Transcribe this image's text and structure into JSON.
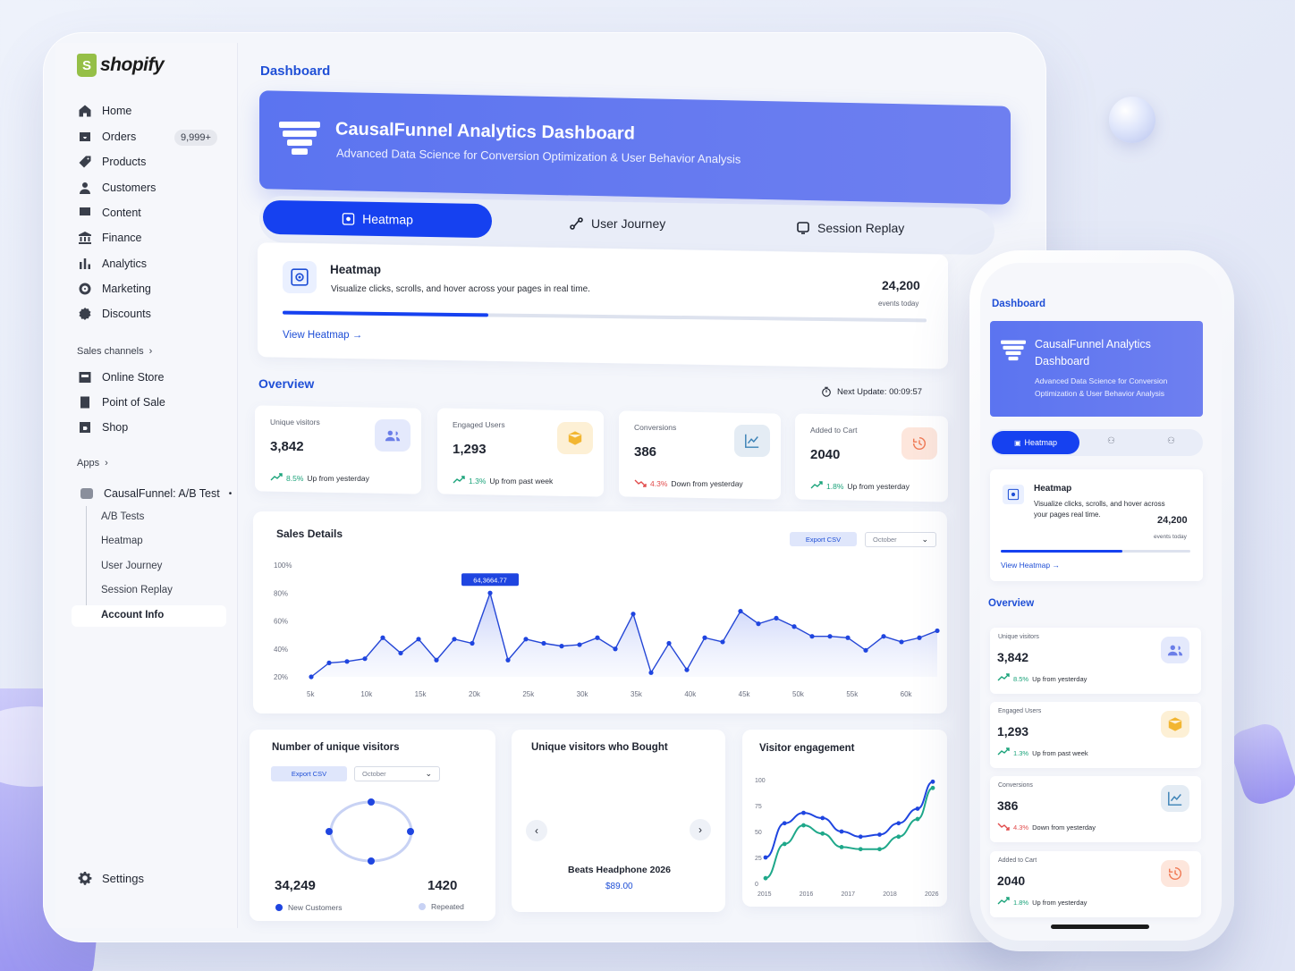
{
  "brand": {
    "name": "shopify"
  },
  "nav": [
    {
      "label": "Home",
      "icon": "home-icon"
    },
    {
      "label": "Orders",
      "icon": "orders-icon",
      "badge": "9,999+"
    },
    {
      "label": "Products",
      "icon": "tag-icon"
    },
    {
      "label": "Customers",
      "icon": "person-icon"
    },
    {
      "label": "Content",
      "icon": "content-icon"
    },
    {
      "label": "Finance",
      "icon": "bank-icon"
    },
    {
      "label": "Analytics",
      "icon": "bar-chart-icon"
    },
    {
      "label": "Marketing",
      "icon": "target-icon"
    },
    {
      "label": "Discounts",
      "icon": "discount-icon"
    }
  ],
  "sales_channels": {
    "title": "Sales channels",
    "items": [
      {
        "label": "Online Store",
        "icon": "store-icon"
      },
      {
        "label": "Point of Sale",
        "icon": "pos-icon"
      },
      {
        "label": "Shop",
        "icon": "shop-icon"
      }
    ]
  },
  "apps": {
    "title": "Apps",
    "app_name": "CausalFunnel: A/B Test",
    "sub_items": [
      "A/B Tests",
      "Heatmap",
      "User Journey",
      "Session Replay",
      "Account Info"
    ]
  },
  "settings_label": "Settings",
  "page_title": "Dashboard",
  "banner": {
    "title": "CausalFunnel Analytics Dashboard",
    "subtitle": "Advanced Data Science for Conversion Optimization & User Behavior Analysis"
  },
  "tabs": [
    "Heatmap",
    "User Journey",
    "Session Replay"
  ],
  "heatmap_card": {
    "title": "Heatmap",
    "description": "Visualize clicks, scrolls, and hover across your pages in real time.",
    "count": "24,200",
    "count_label": "events today",
    "progress": 0.32,
    "link": "View Heatmap"
  },
  "overview": {
    "title": "Overview",
    "next_update_label": "Next Update: 00:09:57",
    "stats": [
      {
        "label": "Unique visitors",
        "value": "3,842",
        "change": "8.5%",
        "change_text": "Up from yesterday",
        "direction": "up",
        "icon": "users-icon",
        "icon_bg": "#e4e9fc",
        "icon_color": "#6b7ee8"
      },
      {
        "label": "Engaged Users",
        "value": "1,293",
        "change": "1.3%",
        "change_text": "Up from past week",
        "direction": "up",
        "icon": "box-icon",
        "icon_bg": "#fdf0d5",
        "icon_color": "#f2b632"
      },
      {
        "label": "Conversions",
        "value": "386",
        "change": "4.3%",
        "change_text": "Down from yesterday",
        "direction": "down",
        "icon": "line-chart-icon",
        "icon_bg": "#e4ecf4",
        "icon_color": "#3b82b6"
      },
      {
        "label": "Added to Cart",
        "value": "2040",
        "change": "1.8%",
        "change_text": "Up from yesterday",
        "direction": "up",
        "icon": "history-icon",
        "icon_bg": "#fde6dc",
        "icon_color": "#f07a55"
      }
    ]
  },
  "sales_details": {
    "title": "Sales Details",
    "export_label": "Export CSV",
    "month": "October",
    "tooltip": "64,3664.77"
  },
  "unique_visitors_card": {
    "title": "Number of unique visitors",
    "export_label": "Export CSV",
    "month": "October",
    "new_value": "34,249",
    "new_label": "New Customers",
    "repeat_value": "1420",
    "repeat_label": "Repeated"
  },
  "bought_card": {
    "title": "Unique visitors who Bought",
    "product_name": "Beats Headphone 2026",
    "product_price": "$89.00"
  },
  "engagement_card": {
    "title": "Visitor engagement"
  },
  "chart_data": [
    {
      "type": "area",
      "title": "Sales Details",
      "x_ticks": [
        "5k",
        "10k",
        "15k",
        "20k",
        "25k",
        "30k",
        "35k",
        "40k",
        "45k",
        "50k",
        "55k",
        "60k"
      ],
      "y_ticks": [
        "20%",
        "40%",
        "60%",
        "80%",
        "100%"
      ],
      "ylim": [
        20,
        100
      ],
      "x": [
        5000,
        6500,
        8500,
        10000,
        11300,
        13300,
        15500,
        17500,
        20000,
        20500,
        22200,
        23200,
        24700,
        27000,
        29700,
        31300,
        33000,
        35000,
        36300,
        37800,
        40000,
        41500,
        43300,
        45000,
        46700,
        48300,
        50000,
        51700,
        53300,
        55000,
        57000,
        58700,
        60000,
        61200
      ],
      "values": [
        20,
        30,
        31,
        33,
        48,
        37,
        47,
        32,
        47,
        44,
        80,
        32,
        47,
        44,
        42,
        43,
        48,
        40,
        65,
        23,
        44,
        25,
        48,
        45,
        67,
        58,
        62,
        56,
        49,
        49,
        48,
        39,
        49,
        45,
        48,
        53
      ],
      "series": [
        {
          "name": "Sales",
          "values": [
            20,
            30,
            31,
            33,
            48,
            37,
            47,
            32,
            47,
            44,
            80,
            32,
            47,
            44,
            42,
            43,
            48,
            40,
            65,
            23,
            44,
            25,
            48,
            45,
            67,
            58,
            62,
            56,
            49,
            49,
            48,
            39,
            49,
            45,
            48,
            53
          ]
        }
      ],
      "annotation": "64,3664.77"
    },
    {
      "type": "line",
      "title": "Visitor engagement",
      "x_ticks": [
        "2015",
        "2016",
        "2017",
        "2018",
        "2026"
      ],
      "y_ticks": [
        "0",
        "25",
        "50",
        "75",
        "100"
      ],
      "ylim": [
        0,
        100
      ],
      "series": [
        {
          "color": "#1f45e0",
          "x": [
            2015,
            2015.5,
            2016,
            2016.5,
            2017,
            2017.5,
            2018,
            2018.5,
            2019,
            2019.4
          ],
          "values": [
            25,
            58,
            68,
            63,
            50,
            45,
            47,
            58,
            72,
            98
          ]
        },
        {
          "color": "#1fa88a",
          "x": [
            2015,
            2015.5,
            2016,
            2016.5,
            2017,
            2017.5,
            2018,
            2018.5,
            2019,
            2019.4
          ],
          "values": [
            5,
            38,
            56,
            48,
            35,
            33,
            33,
            45,
            62,
            92
          ]
        }
      ]
    },
    {
      "type": "scatter",
      "title": "Number of unique visitors",
      "series": [
        {
          "name": "New Customers",
          "values": [
            34249
          ]
        },
        {
          "name": "Repeated",
          "values": [
            1420
          ]
        }
      ]
    }
  ],
  "phone": {
    "title": "Dashboard",
    "banner_title": "CausalFunnel Analytics Dashboard",
    "banner_subtitle": "Advanced Data Science for Conversion Optimization & User Behavior Analysis",
    "tab": "Heatmap",
    "hm_title": "Heatmap",
    "hm_desc": "Visualize clicks, scrolls, and hover across your pages real time.",
    "hm_count": "24,200",
    "hm_count_label": "events today",
    "hm_link": "View Heatmap",
    "overview": "Overview"
  }
}
